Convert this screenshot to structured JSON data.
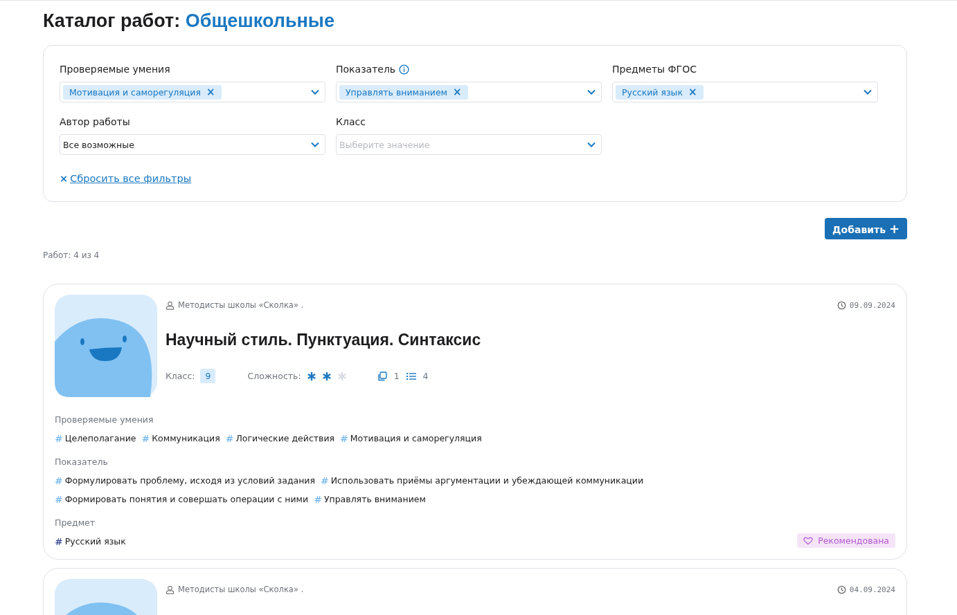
{
  "header": {
    "title": "Каталог работ:",
    "section": "Общешкольные"
  },
  "filters": {
    "fields": [
      {
        "label": "Проверяемые умения",
        "info": false,
        "chips": [
          {
            "text": "Мотивация и саморегуляция",
            "remove": "×"
          }
        ]
      },
      {
        "label": "Показатель",
        "info": true,
        "chips": [
          {
            "text": "Управлять вниманием",
            "remove": "×"
          }
        ]
      },
      {
        "label": "Предметы ФГОС",
        "info": false,
        "chips": [
          {
            "text": "Русский язык",
            "remove": "×"
          }
        ]
      },
      {
        "label": "Автор работы",
        "info": false,
        "value": "Все возможные"
      },
      {
        "label": "Класс",
        "info": false,
        "placeholder": "Выберите значение"
      }
    ],
    "reset": {
      "icon": "×",
      "text": "Сбросить все фильтры"
    }
  },
  "add_button": {
    "text": "Добавить",
    "icon": "+"
  },
  "count": "Работ: 4 из 4",
  "works": [
    {
      "author": "Методисты школы «Сколка» .",
      "date": "09.09.2024",
      "title": "Научный стиль. Пунктуация. Синтаксис",
      "grade_label": "Класс:",
      "grade": "9",
      "complexity_label": "Сложность:",
      "stars": 2,
      "copies": "1",
      "tasks": "4",
      "groups": [
        {
          "kind": "skills",
          "title": "Проверяемые умения",
          "tags": [
            {
              "mark": "#",
              "text": "Целеполагание"
            },
            {
              "mark": "#",
              "text": "Коммуникация"
            },
            {
              "mark": "#",
              "text": "Логические действия"
            },
            {
              "mark": "#",
              "text": "Мотивация и саморегуляция"
            }
          ]
        },
        {
          "kind": "indicators",
          "title": "Показатель",
          "tags": [
            {
              "mark": "#",
              "text": "Формулировать проблему, исходя из условий задания"
            },
            {
              "mark": "#",
              "text": "Использовать приёмы аргументации и убеждающей коммуникации"
            },
            {
              "mark": "#",
              "text": "Формировать понятия и совершать операции с ними"
            },
            {
              "mark": "#",
              "text": "Управлять вниманием"
            }
          ]
        },
        {
          "kind": "subject",
          "title": "Предмет",
          "tags": [
            {
              "mark": "#",
              "text": "Русский язык"
            }
          ]
        }
      ],
      "recommended": {
        "text": "Рекомендована"
      }
    },
    {
      "author": "Методисты школы «Сколка» .",
      "date": "04.09.2024"
    }
  ]
}
